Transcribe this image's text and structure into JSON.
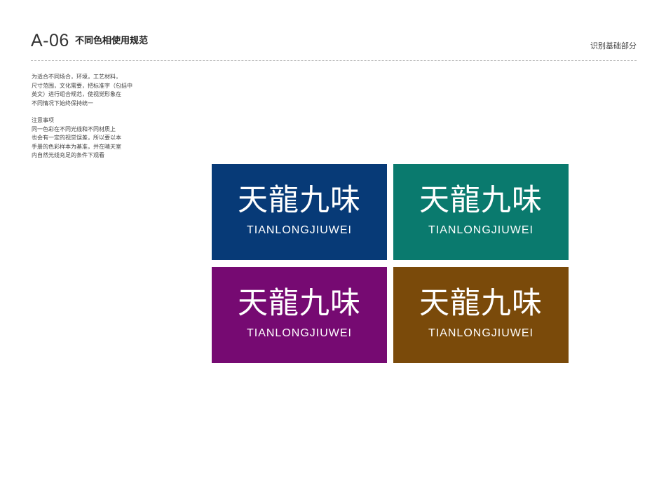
{
  "header": {
    "code": "A-06",
    "title": "不同色相使用规范",
    "section": "识别基础部分"
  },
  "notes": {
    "intro": [
      "为适合不同场合，环境，工艺材料，",
      "尺寸范围，文化需要，把标准字（包括中",
      "英文）进行组合规范，使视觉形象在",
      "不同情况下始终保持统一"
    ],
    "caution_title": "注意事项",
    "caution": [
      "同一色彩在不同光线和不同材质上",
      "也会有一定的视觉误差，所以要以本",
      "手册的色彩样本为基准，并在晴天室",
      "内自然光线充足的条件下观看"
    ]
  },
  "logo": {
    "chinese": "天龍九味",
    "english": "TIANLONGJIUWEI"
  },
  "swatches": [
    {
      "color": "#073A77"
    },
    {
      "color": "#0A7A6E"
    },
    {
      "color": "#760A72"
    },
    {
      "color": "#7A4A0A"
    }
  ]
}
